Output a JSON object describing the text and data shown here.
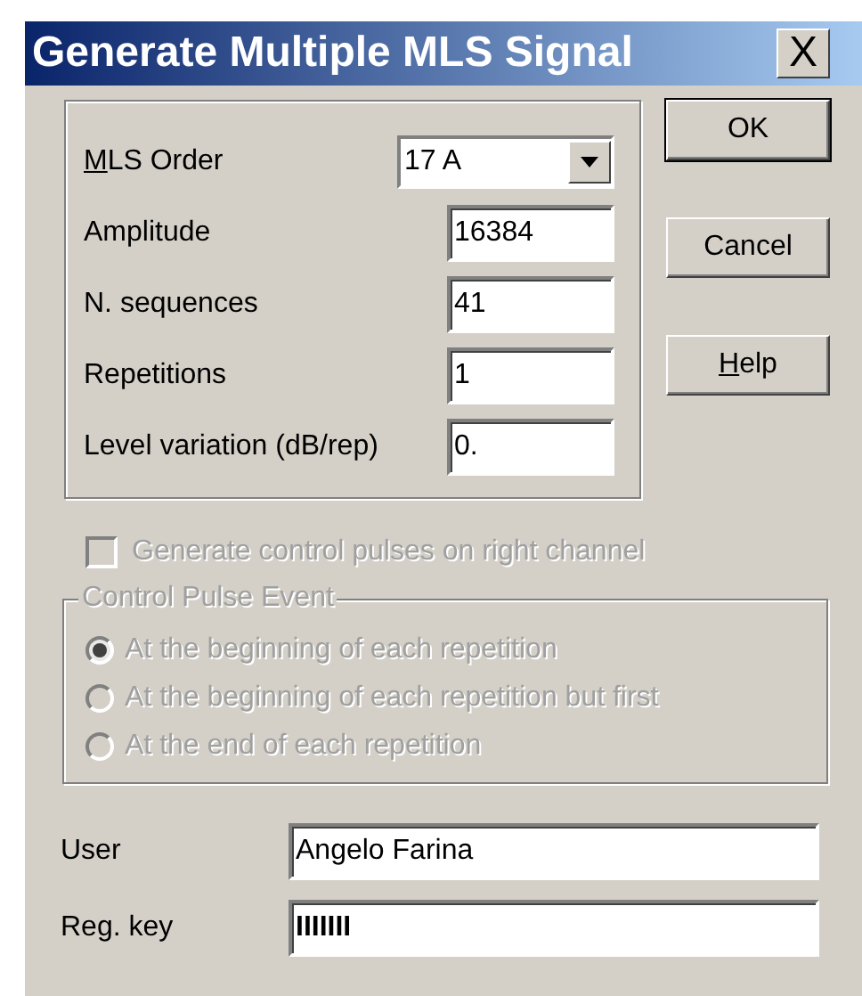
{
  "window": {
    "title": "Generate Multiple MLS Signal",
    "close": "X"
  },
  "fields": [
    {
      "label": "MLS Order",
      "underline_first": true,
      "kind": "combo",
      "value": "17 A"
    },
    {
      "label": "Amplitude",
      "underline_first": false,
      "kind": "text",
      "value": "16384"
    },
    {
      "label": "N. sequences",
      "underline_first": false,
      "kind": "text",
      "value": "41"
    },
    {
      "label": "Repetitions",
      "underline_first": false,
      "kind": "text",
      "value": "1"
    },
    {
      "label": "Level variation (dB/rep)",
      "underline_first": false,
      "kind": "text",
      "value": "0."
    }
  ],
  "buttons": [
    {
      "label": "OK",
      "underline_first": false,
      "default": true
    },
    {
      "label": "Cancel",
      "underline_first": false,
      "default": false
    },
    {
      "label": "Help",
      "underline_first": true,
      "default": false
    }
  ],
  "control_pulses": {
    "label": "Generate control pulses on right channel",
    "checked": false,
    "disabled": true
  },
  "event_group": {
    "title": "Control Pulse Event",
    "disabled": true,
    "options": [
      {
        "label": "At the beginning of each repetition",
        "selected": true
      },
      {
        "label": "At the beginning of each repetition but first",
        "selected": false
      },
      {
        "label": "At the end of each repetition",
        "selected": false
      }
    ]
  },
  "registration": [
    {
      "label": "User",
      "value": "Angelo Farina",
      "masked": false
    },
    {
      "label": "Reg. key",
      "value": "IIIIIII",
      "masked": true
    }
  ]
}
